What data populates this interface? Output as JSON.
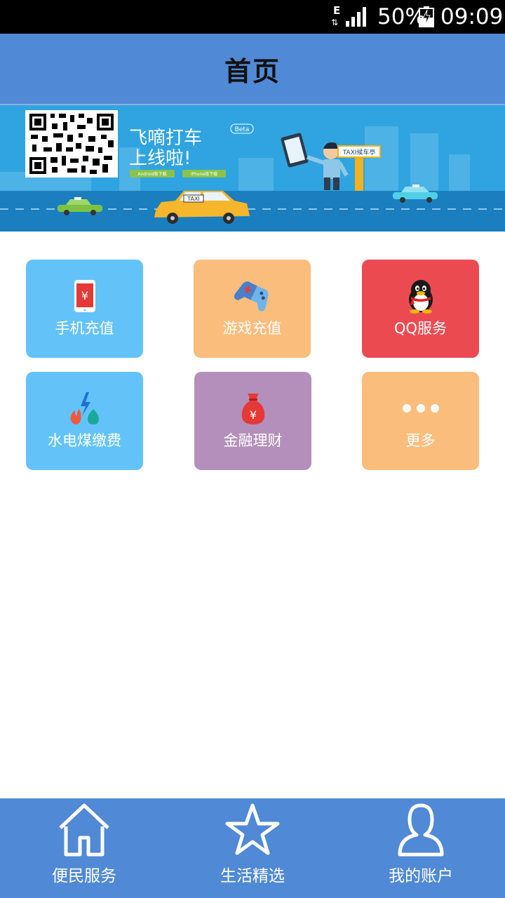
{
  "status_bar": {
    "network": "E",
    "battery_percent": "50%",
    "time": "09:09"
  },
  "header": {
    "title": "首页"
  },
  "banner": {
    "headline_line1": "飞嘀打车",
    "headline_line2": "上线啦!",
    "beta_tag": "Beta",
    "android_button": "Android版下载",
    "iphone_button": "iPhone版下载",
    "sign_text": "TAXI候车亭",
    "taxi_roof": "TAXI"
  },
  "services": [
    {
      "label": "手机充值",
      "color": "#63c3f8",
      "icon": "phone-yuan-icon"
    },
    {
      "label": "游戏充值",
      "color": "#fbbd7c",
      "icon": "gamepad-icon"
    },
    {
      "label": "QQ服务",
      "color": "#ec4a51",
      "icon": "qq-penguin-icon"
    },
    {
      "label": "水电煤缴费",
      "color": "#63c3f8",
      "icon": "utilities-icon"
    },
    {
      "label": "金融理财",
      "color": "#b48fbb",
      "icon": "money-bag-icon"
    },
    {
      "label": "更多",
      "color": "#fbbd7c",
      "icon": "more-dots-icon"
    }
  ],
  "bottom_nav": [
    {
      "label": "便民服务",
      "icon": "home-icon"
    },
    {
      "label": "生活精选",
      "icon": "star-icon"
    },
    {
      "label": "我的账户",
      "icon": "user-icon"
    }
  ],
  "colors": {
    "header_bg": "#5089d6",
    "status_bar_bg": "#000000"
  }
}
